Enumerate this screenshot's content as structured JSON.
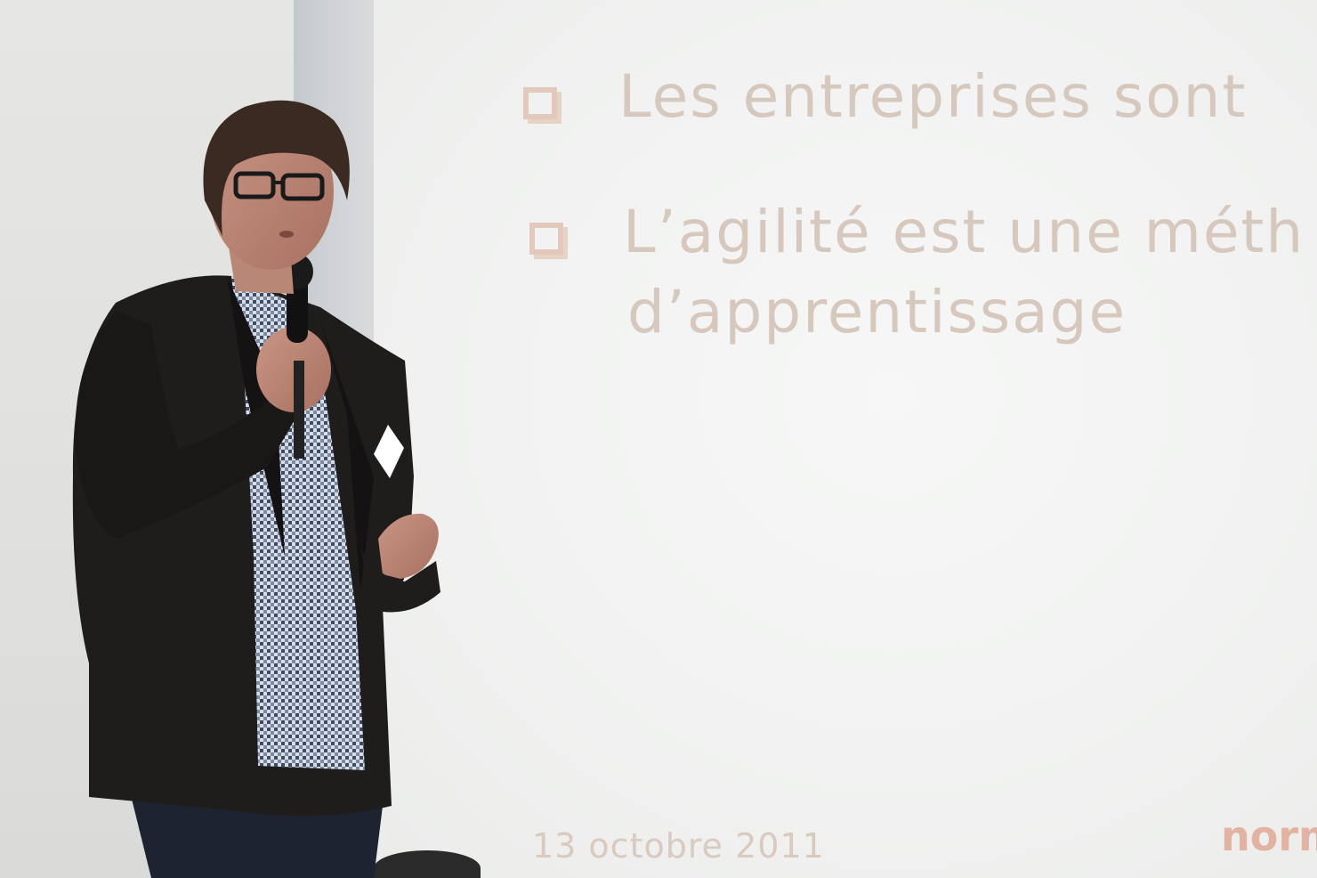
{
  "slide": {
    "bullets": [
      "Les entreprises sont",
      "L’agilité est une méth",
      "d’apprentissage"
    ],
    "date": "13 octobre 2011",
    "logo_fragment": "norm"
  },
  "colors": {
    "slide_text": "#d7c8be",
    "bullet": "#e2c9bb",
    "logo": "#e2b3a2",
    "jacket": "#1f1c1c"
  },
  "icons": {
    "bullet": "checkbox-square-icon"
  }
}
